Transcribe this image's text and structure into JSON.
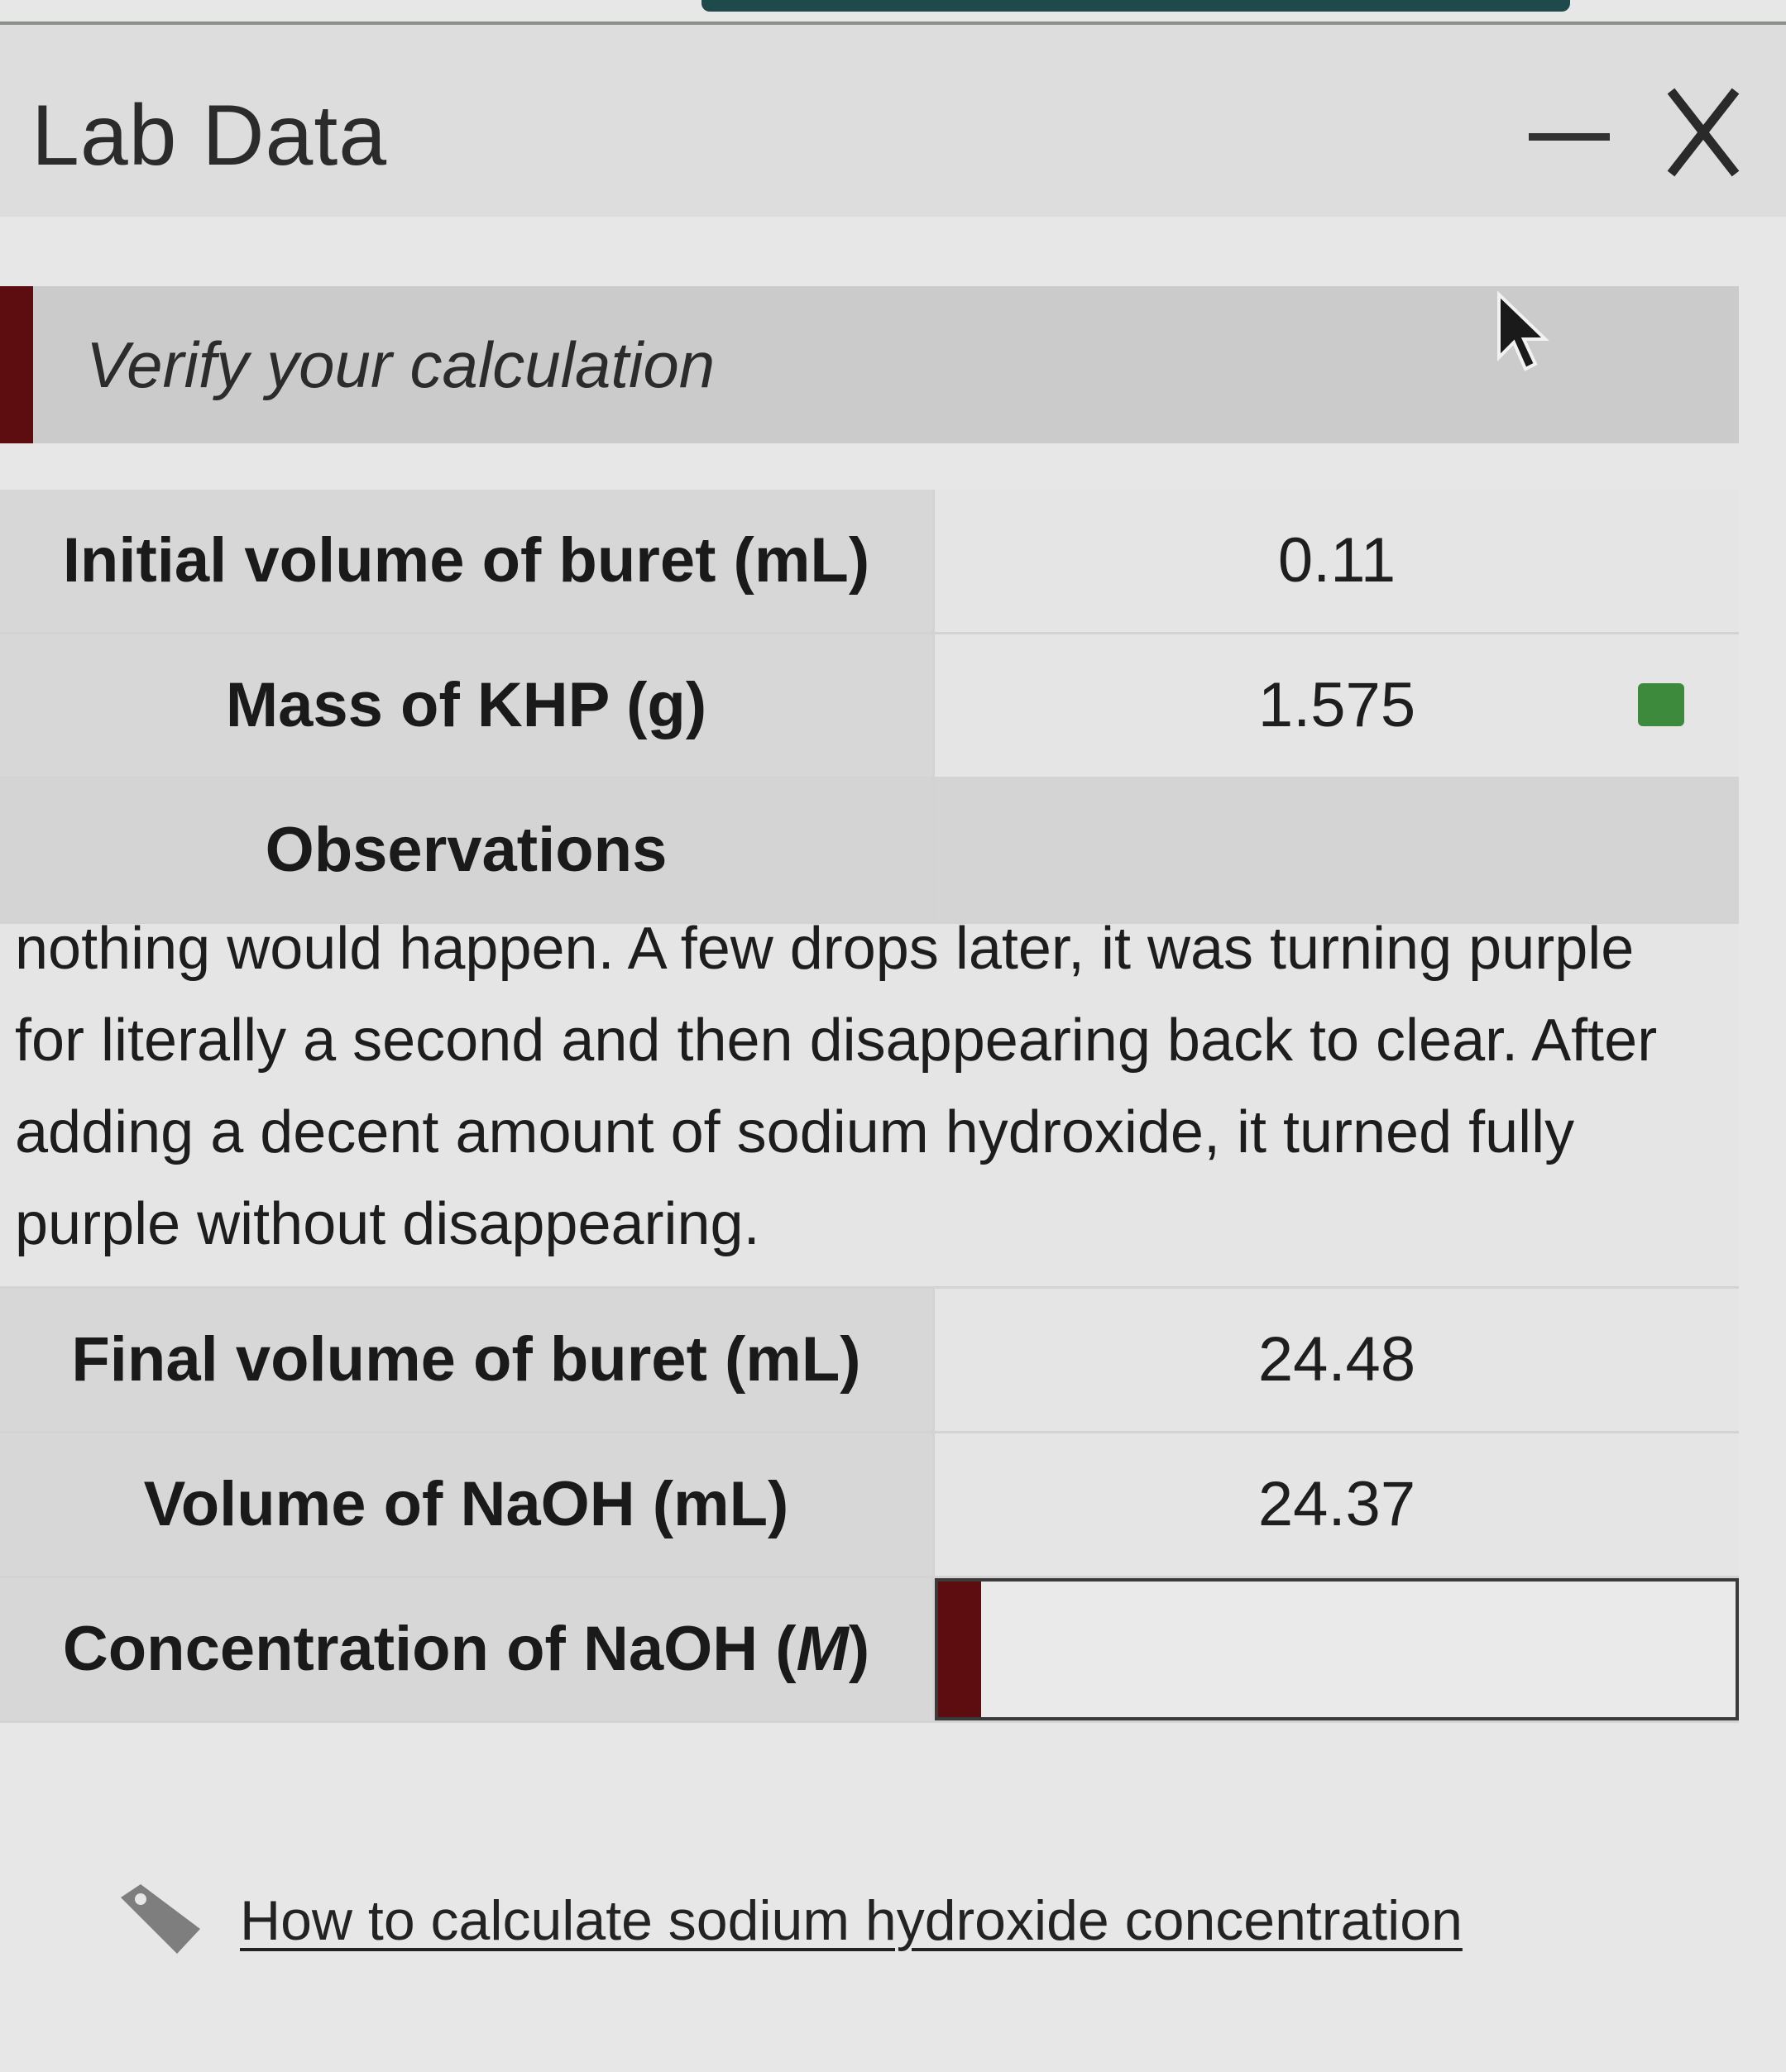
{
  "window": {
    "title": "Lab Data",
    "minimize_icon": "minimize-icon",
    "close_icon": "close-icon"
  },
  "banner": {
    "text": "Verify your calculation",
    "accent_color": "#5d0d0f"
  },
  "table": {
    "initial_volume": {
      "label": "Initial volume of buret (mL)",
      "value": "0.11"
    },
    "mass_khp": {
      "label": "Mass of KHP (g)",
      "value": "1.575"
    },
    "observations": {
      "label": "Observations",
      "text": "nothing would happen. A few drops later, it was turning purple for literally a second and then disappearing back to clear. After adding a decent amount of sodium hydroxide, it turned fully purple without disappearing."
    },
    "final_volume": {
      "label": "Final volume of buret (mL)",
      "value": "24.48"
    },
    "volume_naoh": {
      "label": "Volume of NaOH (mL)",
      "value": "24.37"
    },
    "concentration": {
      "label_prefix": "Concentration of NaOH (",
      "label_unit": "M",
      "label_suffix": ")",
      "value": ""
    }
  },
  "help": {
    "link_text": "How to calculate sodium hydroxide concentration",
    "icon": "tag-icon"
  }
}
